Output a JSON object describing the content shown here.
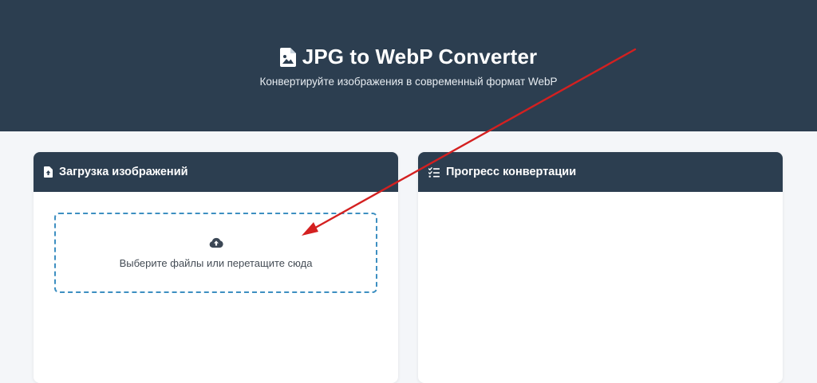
{
  "header": {
    "title": "JPG to WebP Converter",
    "subtitle": "Конвертируйте изображения в современный формат WebP",
    "icon": "image-file-icon"
  },
  "upload_card": {
    "title": "Загрузка изображений",
    "icon": "file-upload-icon",
    "dropzone": {
      "text": "Выберите файлы или перетащите сюда",
      "icon": "cloud-upload-icon"
    }
  },
  "progress_card": {
    "title": "Прогресс конвертации",
    "icon": "task-list-icon"
  },
  "colors": {
    "header_bg": "#2c3e50",
    "page_bg": "#f4f6f9",
    "dropzone_border": "#3d8fc1",
    "annotation_arrow": "#d42020"
  }
}
